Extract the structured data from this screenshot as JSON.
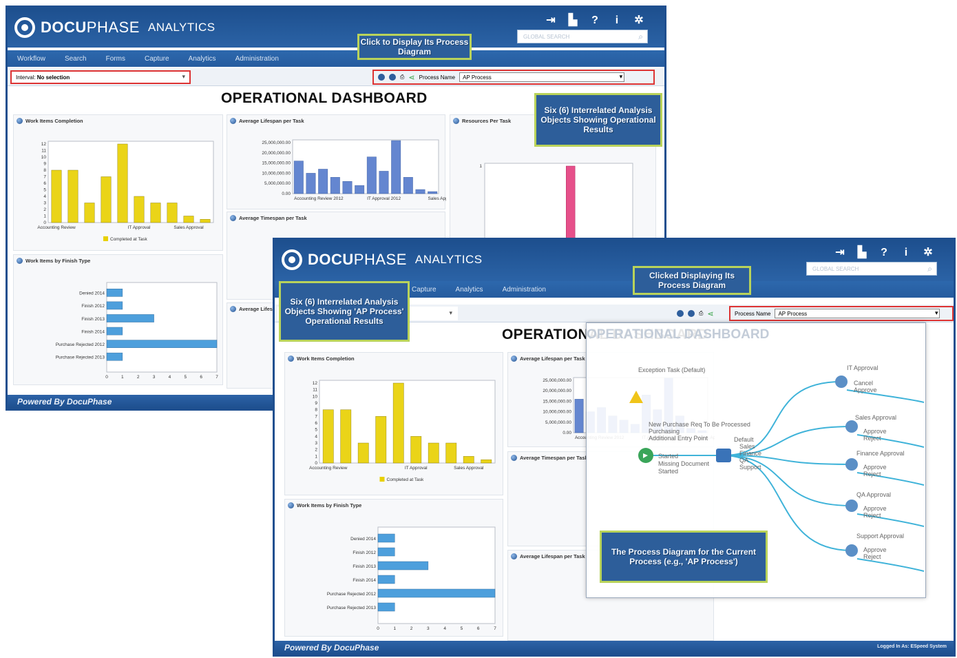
{
  "app": {
    "brand_bold": "DOCU",
    "brand_thin": "PHASE",
    "product": "ANALYTICS",
    "search_placeholder": "GLOBAL SEARCH",
    "nav": [
      "Workflow",
      "Search",
      "Forms",
      "Capture",
      "Analytics",
      "Administration"
    ],
    "footer": "Powered By DocuPhase",
    "footer_right": "Logged In As: ESpeed System",
    "top_icons": [
      "logout-icon",
      "reports-icon",
      "help-icon",
      "info-icon",
      "settings-icon"
    ]
  },
  "toolbar": {
    "interval_label": "Interval",
    "interval_value": "No selection",
    "process_label": "Process Name",
    "process_value": "AP Process"
  },
  "dashboard_title": "OPERATIONAL DASHBOARD",
  "panels": {
    "p1": "Work Items Completion",
    "p2": "Average Lifespan per Task",
    "p3": "Resources Per Task",
    "p4": "Work Items by Finish Type",
    "p5": "Average Timespan per Task",
    "p6": "Average Lifespan per Task"
  },
  "callouts": {
    "c1": "Click to Display Its Process Diagram",
    "c2": "Six (6) Interrelated Analysis Objects Showing Operational Results",
    "c3": "Six (6) Interrelated Analysis Objects Showing 'AP Process' Operational Results",
    "c4": "Clicked Displaying Its Process Diagram",
    "c5": "The Process Diagram for the Current Process (e.g., 'AP Process')"
  },
  "process_diagram": {
    "labels": [
      "Exception Task (Default)",
      "New Purchase Req To Be Processed",
      "Purchasing",
      "Additional Entry Point",
      "Started",
      "Missing Document",
      "Started",
      "IT Approval",
      "Cancel",
      "Approve",
      "Sales Approval",
      "Approve",
      "Reject",
      "Finance Approval",
      "Approve",
      "Reject",
      "QA Approval",
      "Approve",
      "Reject",
      "Support Approval",
      "Approve",
      "Reject",
      "Default",
      "Sales",
      "Finance",
      "QA",
      "Support"
    ]
  },
  "chart_data": [
    {
      "type": "bar",
      "title": "Work Items Completion",
      "categories": [
        "Accounting Review",
        "",
        "",
        "",
        "",
        "IT Approval",
        "",
        "",
        "Sales Approval",
        ""
      ],
      "values": [
        8,
        8,
        3,
        7,
        12,
        4,
        3,
        3,
        1,
        0.5
      ],
      "ylim": [
        0,
        12
      ],
      "yticks": [
        "0",
        "1",
        "2",
        "3",
        "4",
        "5",
        "6",
        "7",
        "8",
        "9",
        "10",
        "11",
        "12"
      ],
      "legend": "Completed at Task",
      "color": "#e8d000"
    },
    {
      "type": "bar",
      "title": "Average Lifespan per Task",
      "categories": [
        "Accounting Review 2012",
        "",
        "",
        "",
        "",
        "",
        "IT Approval 2012",
        "",
        "",
        "",
        "",
        "Sales Approval 2012"
      ],
      "values": [
        16000000,
        10000000,
        12000000,
        8000000,
        6000000,
        4000000,
        18000000,
        11000000,
        26000000,
        8000000,
        2000000,
        1000000
      ],
      "ylim": [
        0,
        25000000
      ],
      "yticks": [
        "0.00",
        "5,000,000.00",
        "10,000,000.00",
        "15,000,000.00",
        "20,000,000.00",
        "25,000,000.00"
      ],
      "color": "#4a72c8"
    },
    {
      "type": "bar",
      "title": "Work Items by Finish Type",
      "orientation": "horizontal",
      "categories": [
        "Denied 2014",
        "Finish 2012",
        "Finish 2013",
        "Finish 2014",
        "Purchase Rejected 2012",
        "Purchase Rejected 2013"
      ],
      "values": [
        1,
        1,
        3,
        1,
        7,
        1
      ],
      "xlim": [
        0,
        7
      ],
      "xticks": [
        "0",
        "1",
        "2",
        "3",
        "4",
        "5",
        "6",
        "7"
      ],
      "color": "#2e8fd6"
    },
    {
      "type": "bar",
      "title": "Resources Per Task",
      "values": [
        0.3,
        0.3,
        1,
        0.3,
        0.3
      ],
      "ylim": [
        0,
        1
      ],
      "yticks": [
        "1",
        "2"
      ],
      "color": "#e6508a"
    }
  ]
}
